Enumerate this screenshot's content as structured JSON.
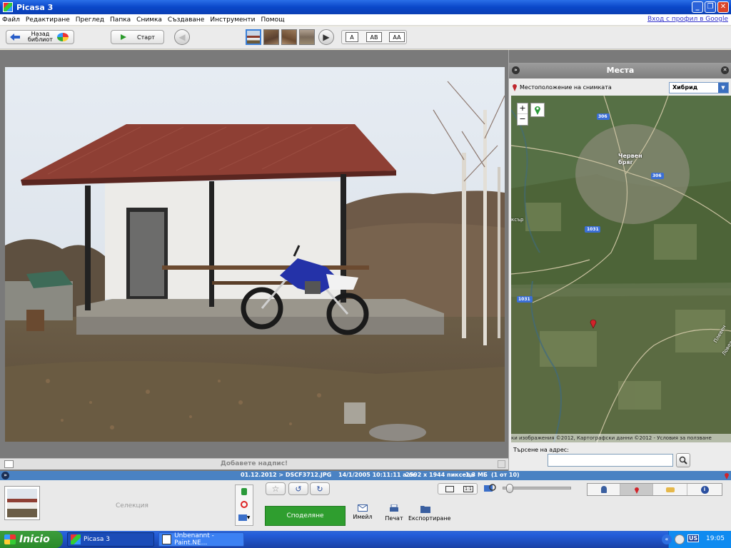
{
  "window": {
    "title": "Picasa 3"
  },
  "menu": {
    "items": [
      "Файл",
      "Редактиране",
      "Преглед",
      "Папка",
      "Снимка",
      "Създаване",
      "Инструменти",
      "Помощ"
    ],
    "signin": "Вход с профил в Google"
  },
  "toolbar": {
    "back_label": "Назад",
    "back_sub": "библиот",
    "start_label": "Старт",
    "text_buttons": [
      "A",
      "AB",
      "AA"
    ]
  },
  "viewer": {
    "caption_placeholder": "Добавете надпис!"
  },
  "places": {
    "title": "Места",
    "location_label": "Местоположение на снимката",
    "map_type": "Хибрид",
    "zoom_in": "+",
    "zoom_out": "−",
    "map_labels": {
      "town": "Червен\nбряг",
      "road_306a": "306",
      "road_306b": "306",
      "road_1031a": "1031",
      "road_1031b": "1031",
      "edge_left": "ксър",
      "edge_right_a": "Плевен",
      "edge_right_b": "Ловеч"
    },
    "attribution": "ки изображения ©2012, Картографски данни ©2012 - Условия за ползване",
    "search_label": "Търсене на адрес:",
    "search_value": ""
  },
  "status": {
    "path": "01.12.2012 > DSCF3712.JPG",
    "datetime": "14/1/2005 10:11:11 a.m.",
    "dimensions": "2592 x 1944 пиксела",
    "size": "1,3 МБ",
    "count": "(1 от 10)"
  },
  "bottom": {
    "selection_label": "Селекция",
    "share_label": "Споделяне",
    "email_label": "Имейл",
    "print_label": "Печат",
    "export_label": "Експортиране",
    "zoom_level": 0.05
  },
  "taskbar": {
    "start_label": "Inicio",
    "tasks": [
      "Picasa 3",
      "Unbenannt - Paint.NE..."
    ],
    "lang": "US",
    "clock": "19:05"
  },
  "colors": {
    "title_blue": "#0a47c9",
    "status_blue": "#4a82c3",
    "share_green": "#2f9e2f",
    "taskbar_blue": "#245edb",
    "start_green": "#3c9d3c"
  }
}
